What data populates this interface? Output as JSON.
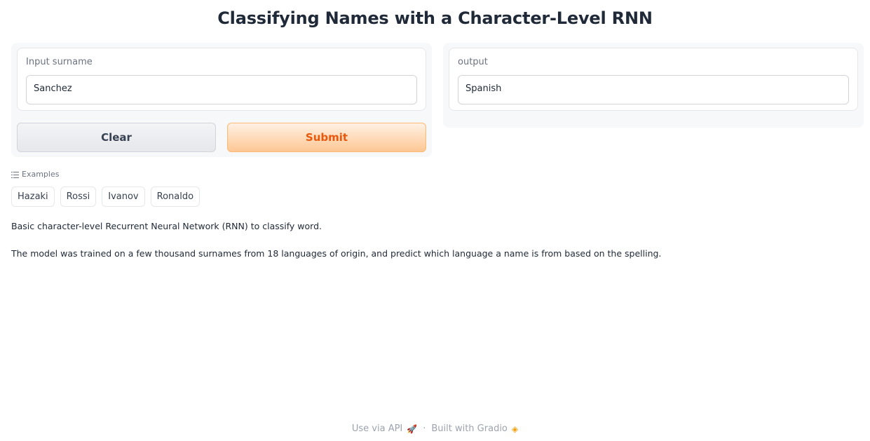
{
  "page": {
    "title": "Classifying Names with a Character-Level RNN"
  },
  "input": {
    "label": "Input surname",
    "value": "Sanchez"
  },
  "output": {
    "label": "output",
    "value": "Spanish"
  },
  "buttons": {
    "clear": "Clear",
    "submit": "Submit"
  },
  "examples": {
    "header": "Examples",
    "items": [
      "Hazaki",
      "Rossi",
      "Ivanov",
      "Ronaldo"
    ]
  },
  "description": {
    "line1": "Basic character-level Recurrent Neural Network (RNN) to classify word.",
    "line2": "The model was trained on a few thousand surnames from 18 languages of origin, and predict which language a name is from based on the spelling."
  },
  "footer": {
    "api": "Use via API",
    "separator": "·",
    "built": "Built with Gradio"
  },
  "colors": {
    "accent": "#ea580c",
    "submit_bg": "#fdc794"
  }
}
